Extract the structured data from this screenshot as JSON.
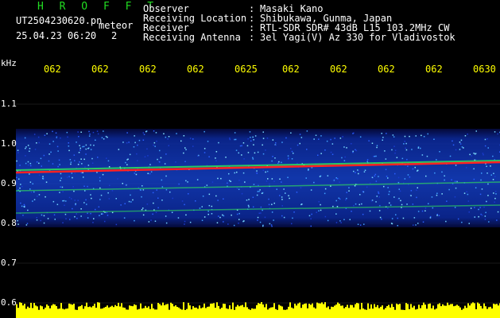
{
  "app": {
    "title": "H R O F F T",
    "filename": "UT2504230620.pn",
    "mode": "meteor",
    "date": "25.04.23 06:20",
    "date_extra": "2"
  },
  "meta": [
    {
      "label": "Observer",
      "value": "Masaki Kano"
    },
    {
      "label": "Receiving Location",
      "value": "Shibukawa, Gunma, Japan"
    },
    {
      "label": "Receiver",
      "value": "RTL-SDR SDR# 43dB L15 103.2MHz CW"
    },
    {
      "label": "Receiving Antenna",
      "value": "3el Yagi(V) Az 330 for Vladivostok"
    }
  ],
  "axis": {
    "unit": "kHz",
    "y_ticks": [
      "1.1",
      "1.0",
      "0.9",
      "0.8",
      "0.7",
      "0.6"
    ],
    "x_ticks": [
      "062",
      "062",
      "062",
      "062",
      "0625",
      "062",
      "062",
      "062",
      "062",
      "0630"
    ]
  },
  "colors": {
    "header_green": "#22dd22",
    "time_label": "#ffff00",
    "spectrogram_bg": "#0a1a80",
    "signal_trace": "#ff2222",
    "signal_line": "#33ee55",
    "power_bar": "#ffff00"
  }
}
